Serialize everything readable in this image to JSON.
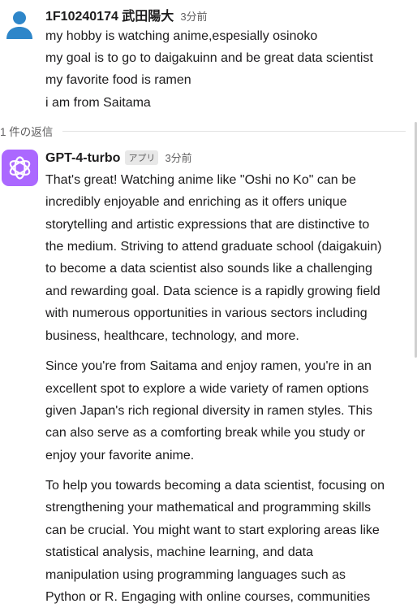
{
  "original_message": {
    "author": "1F10240174 武田陽大",
    "time": "3分前",
    "lines": [
      "my hobby is watching anime,espesially osinoko",
      "my goal is to go to daigakuinn and be great data scientist",
      "my favorite food is ramen",
      "i am from Saitama"
    ]
  },
  "thread": {
    "reply_count_label": "1 件の返信"
  },
  "reply_message": {
    "author": "GPT-4-turbo",
    "badge": "アプリ",
    "time": "3分前",
    "paragraph1": [
      "That's great! Watching anime like \"Oshi no Ko\" can be",
      "incredibly enjoyable and enriching as it offers unique",
      "storytelling and artistic expressions that are distinctive to",
      "the medium. Striving to attend graduate school (daigakuin)",
      "to become a data scientist also sounds like a challenging",
      "and rewarding goal. Data science is a rapidly growing field",
      "with numerous opportunities in various sectors including",
      "business, healthcare, technology, and more."
    ],
    "paragraph2": [
      "Since you're from Saitama and enjoy ramen, you're in an",
      "excellent spot to explore a wide variety of ramen options",
      "given Japan's rich regional diversity in ramen styles. This",
      "can also serve as a comforting break while you study or",
      "enjoy your favorite anime."
    ],
    "paragraph3": [
      "To help you towards becoming a data scientist, focusing on",
      "strengthening your mathematical and programming skills",
      "can be crucial. You might want to start exploring areas like",
      "statistical analysis, machine learning, and data",
      "manipulation using programming languages such as",
      "Python or R. Engaging with online courses, communities"
    ]
  },
  "colors": {
    "user_avatar": "#2e86c9",
    "bot_avatar": "#ab68ff"
  },
  "icons": {
    "user_avatar": "person-silhouette-icon",
    "bot_avatar": "openai-logo-icon"
  }
}
